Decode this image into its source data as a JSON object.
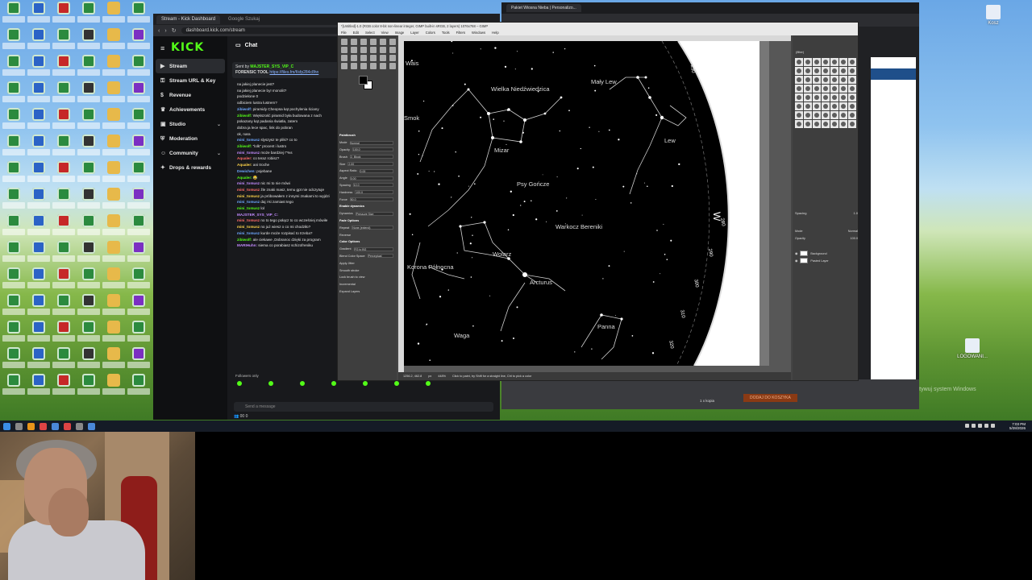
{
  "browser": {
    "tabs": [
      {
        "label": "Stream - Kick Dashboard"
      },
      {
        "label": "Google Szukaj"
      }
    ],
    "url": "dashboard.kick.com/stream"
  },
  "kick": {
    "logo": "KICK",
    "nav": [
      {
        "label": "Stream",
        "icon": "stream-icon",
        "active": true
      },
      {
        "label": "Stream URL & Key",
        "icon": "key-icon"
      },
      {
        "label": "Revenue",
        "icon": "revenue-icon"
      },
      {
        "label": "Achievements",
        "icon": "trophy-icon"
      },
      {
        "label": "Studio",
        "icon": "studio-icon",
        "chevron": true
      },
      {
        "label": "Moderation",
        "icon": "shield-icon"
      },
      {
        "label": "Community",
        "icon": "community-icon",
        "chevron": true
      },
      {
        "label": "Drops & rewards",
        "icon": "gift-icon"
      }
    ],
    "chat": {
      "title": "Chat",
      "pinned_by": "Sent by",
      "pinned_user": "MAJSTER_SYS_VIP_C",
      "pinned_text": "FORENSIC TOOL",
      "pinned_link": "https://files.fm/f/sfp284c8hn",
      "messages": [
        {
          "user": "",
          "text": "na jakiej planecie jest?"
        },
        {
          "user": "",
          "text": "na jakiej planecie by! monolit?"
        },
        {
          "user": "",
          "text": "podzielone 0"
        },
        {
          "user": "",
          "text": "odbiciem lustra lustrem?"
        },
        {
          "user": "zibiwolf:",
          "text": "piramidy Cheopsa kąt pochylenia ściany"
        },
        {
          "user": "zibiwolf:",
          "text": "Większość piramid była budowana z nach"
        },
        {
          "user": "",
          "text": "pokazany kąt padania światła, zatem"
        },
        {
          "user": "",
          "text": "dobra ja lece spac, link do pobran"
        },
        {
          "user": "",
          "text": "ok, nara"
        },
        {
          "user": "mini_tomusz",
          "text": "slyszysz te pliki? co to"
        },
        {
          "user": "zibiwolf:",
          "text": "\"lolk\" procent i lustro"
        },
        {
          "user": "mini_tomusz",
          "text": "może bardziej !\"%s"
        },
        {
          "user": "Aqualer:",
          "text": "co teraz robisz?"
        },
        {
          "user": "Aqualer:",
          "text": "ani troche"
        },
        {
          "user": "Dewichen:",
          "text": "pojebane"
        },
        {
          "user": "Aqualer:",
          "text": "😂"
        },
        {
          "user": "mini_tomusz",
          "text": "nic mi to nie mówi"
        },
        {
          "user": "mini_tomusz",
          "text": "źle znaki masz, temu gpt nie odczytuje"
        },
        {
          "user": "mini_tomusz",
          "text": "ja próbowałem z innymi znakami to wyjdzi"
        },
        {
          "user": "mini_tomusz",
          "text": "daj i-ki zamiast tego"
        },
        {
          "user": "mini_tomusz",
          "text": "lol"
        },
        {
          "user": "MAJSTER_SYS_VIP_C:",
          "text": ""
        },
        {
          "user": "mini_tomusz",
          "text": "no to tego połącz to co wcześniej mówiłe"
        },
        {
          "user": "mini_tomusz",
          "text": "no już wiesz o co mi chodziło?"
        },
        {
          "user": "mini_tomusz",
          "text": "kurde może rozpisać to trzeba?"
        },
        {
          "user": "zibiwolf:",
          "text": "ale ciekawe ,Dobranoc dzięki za program"
        },
        {
          "user": "MARIHuhn:",
          "text": "siema co porabiasz schizofreniku"
        }
      ],
      "followers_only": "Followers only",
      "input_placeholder": "Send a message",
      "viewer_count": "00",
      "other_count": "0"
    }
  },
  "browser2": {
    "tab_label": "Pakiet Wiosna Nieba | Personalizo...",
    "cart_button": "DODAJ DO KOSZYKA",
    "quantity_text": "1 x kopia"
  },
  "gimp": {
    "title": "*[Untitled]-1.0 (RGB color 8-bit non-linear integer, GIMP built-in sRGB, 2 layers) 1076x768 – GIMP",
    "menu": [
      "File",
      "Edit",
      "Select",
      "View",
      "Image",
      "Layer",
      "Colors",
      "Tools",
      "Filters",
      "Windows",
      "Help"
    ],
    "tool_options": [
      {
        "label": "Paintbrush",
        "header": true
      },
      {
        "label": "Mode",
        "value": "Normal"
      },
      {
        "label": "Opacity",
        "value": "100.0"
      },
      {
        "label": "Brush",
        "value": "2. Block"
      },
      {
        "label": "Size",
        "value": "2.00"
      },
      {
        "label": "Aspect Ratio",
        "value": "0.00"
      },
      {
        "label": "Angle",
        "value": "0.00"
      },
      {
        "label": "Spacing",
        "value": "10.0"
      },
      {
        "label": "Hardness",
        "value": "100.0"
      },
      {
        "label": "Force",
        "value": "50.0"
      },
      {
        "label": "Enable dynamics",
        "header": true
      },
      {
        "label": "Dynamics",
        "value": "Pressure Size"
      },
      {
        "label": "Fade Options",
        "header": true
      },
      {
        "label": "Repeat",
        "value": "None (extend)"
      },
      {
        "label": "Reverse",
        "value": ""
      },
      {
        "label": "Color Options",
        "header": true
      },
      {
        "label": "Gradient",
        "value": "FG to BG"
      },
      {
        "label": "Blend Color Space",
        "value": "Perceptual"
      },
      {
        "label": "Apply Jitter",
        "value": ""
      },
      {
        "label": "Smooth stroke",
        "value": ""
      },
      {
        "label": "Lock brush to view",
        "value": ""
      },
      {
        "label": "Incremental",
        "value": ""
      },
      {
        "label": "Expand Layers",
        "value": ""
      }
    ],
    "status": {
      "coords": "1256.2, 462.8",
      "unit": "px",
      "zoom": "448%",
      "hint": "Click to paint, try Shift for a straight line, Ctrl to pick a color"
    },
    "dock": {
      "filter_label": "(filter)",
      "spacing_label": "Spacing",
      "spacing_value": "1.0",
      "mode_label": "Mode",
      "mode_value": "Normal",
      "opacity_label": "Opacity",
      "opacity_value": "100.0",
      "layers": [
        {
          "name": "Background"
        },
        {
          "name": "Pasted Layer"
        }
      ]
    },
    "starmap": {
      "labels": [
        {
          "text": "Wielka Niedźwiedzica"
        },
        {
          "text": "Mały Lew"
        },
        {
          "text": "Psy Gończe"
        },
        {
          "text": "Mizar"
        },
        {
          "text": "Lew"
        },
        {
          "text": "Warkocz Bereniki"
        },
        {
          "text": "Wolarz"
        },
        {
          "text": "Arcturus"
        },
        {
          "text": "Korona Północna"
        },
        {
          "text": "Panna"
        },
        {
          "text": "Waga"
        },
        {
          "text": "Smok"
        },
        {
          "text": "Wais"
        }
      ],
      "compass_w": "W",
      "ticks": [
        "230",
        "240",
        "250",
        "260",
        "270",
        "280",
        "290",
        "300",
        "310",
        "320"
      ]
    }
  },
  "desktop": {
    "right_icons": [
      {
        "label": "Kosz"
      },
      {
        "label": "LOGOWANI..."
      }
    ],
    "watermark": "Aktywuj system Windows"
  },
  "taskbar": {
    "time": "7:03 PM",
    "date": "5/28/2026"
  }
}
